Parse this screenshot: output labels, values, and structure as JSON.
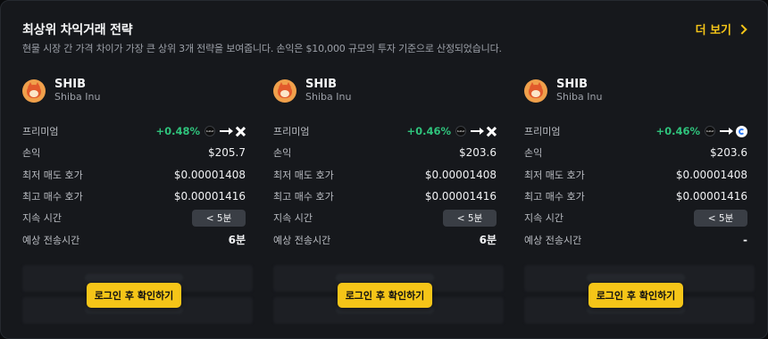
{
  "header": {
    "title": "최상위 차익거래 전략",
    "subtitle": "현물 시장 간 가격 차이가 가장 큰 상위 3개 전략을 보여줍니다. 손익은 $10,000 규모의 투자 기준으로 산정되었습니다.",
    "more_label": "더 보기"
  },
  "labels": {
    "premium": "프리미엄",
    "pnl": "손익",
    "lowest_ask": "최저 매도 호가",
    "highest_bid": "최고 매수 호가",
    "duration": "지속 시간",
    "transfer_time": "예상 전송시간"
  },
  "cards": [
    {
      "symbol": "SHIB",
      "name": "Shiba Inu",
      "premium": "+0.48%",
      "pnl": "$205.7",
      "lowest_ask": "$0.00001408",
      "highest_bid": "$0.00001416",
      "duration": "< 5분",
      "transfer_time": "6분",
      "from_exchange_icon": "bullet-exchange-icon",
      "to_exchange_icon": "x-exchange-icon",
      "login_label": "로그인 후 확인하기"
    },
    {
      "symbol": "SHIB",
      "name": "Shiba Inu",
      "premium": "+0.46%",
      "pnl": "$203.6",
      "lowest_ask": "$0.00001408",
      "highest_bid": "$0.00001416",
      "duration": "< 5분",
      "transfer_time": "6분",
      "from_exchange_icon": "bullet-exchange-icon",
      "to_exchange_icon": "x-exchange-icon",
      "login_label": "로그인 후 확인하기"
    },
    {
      "symbol": "SHIB",
      "name": "Shiba Inu",
      "premium": "+0.46%",
      "pnl": "$203.6",
      "lowest_ask": "$0.00001408",
      "highest_bid": "$0.00001416",
      "duration": "< 5분",
      "transfer_time": "-",
      "from_exchange_icon": "bullet-exchange-icon",
      "to_exchange_icon": "c-exchange-icon",
      "login_label": "로그인 후 확인하기"
    }
  ],
  "colors": {
    "accent": "#f5c518",
    "positive": "#2fc37c",
    "background": "#16181c"
  }
}
